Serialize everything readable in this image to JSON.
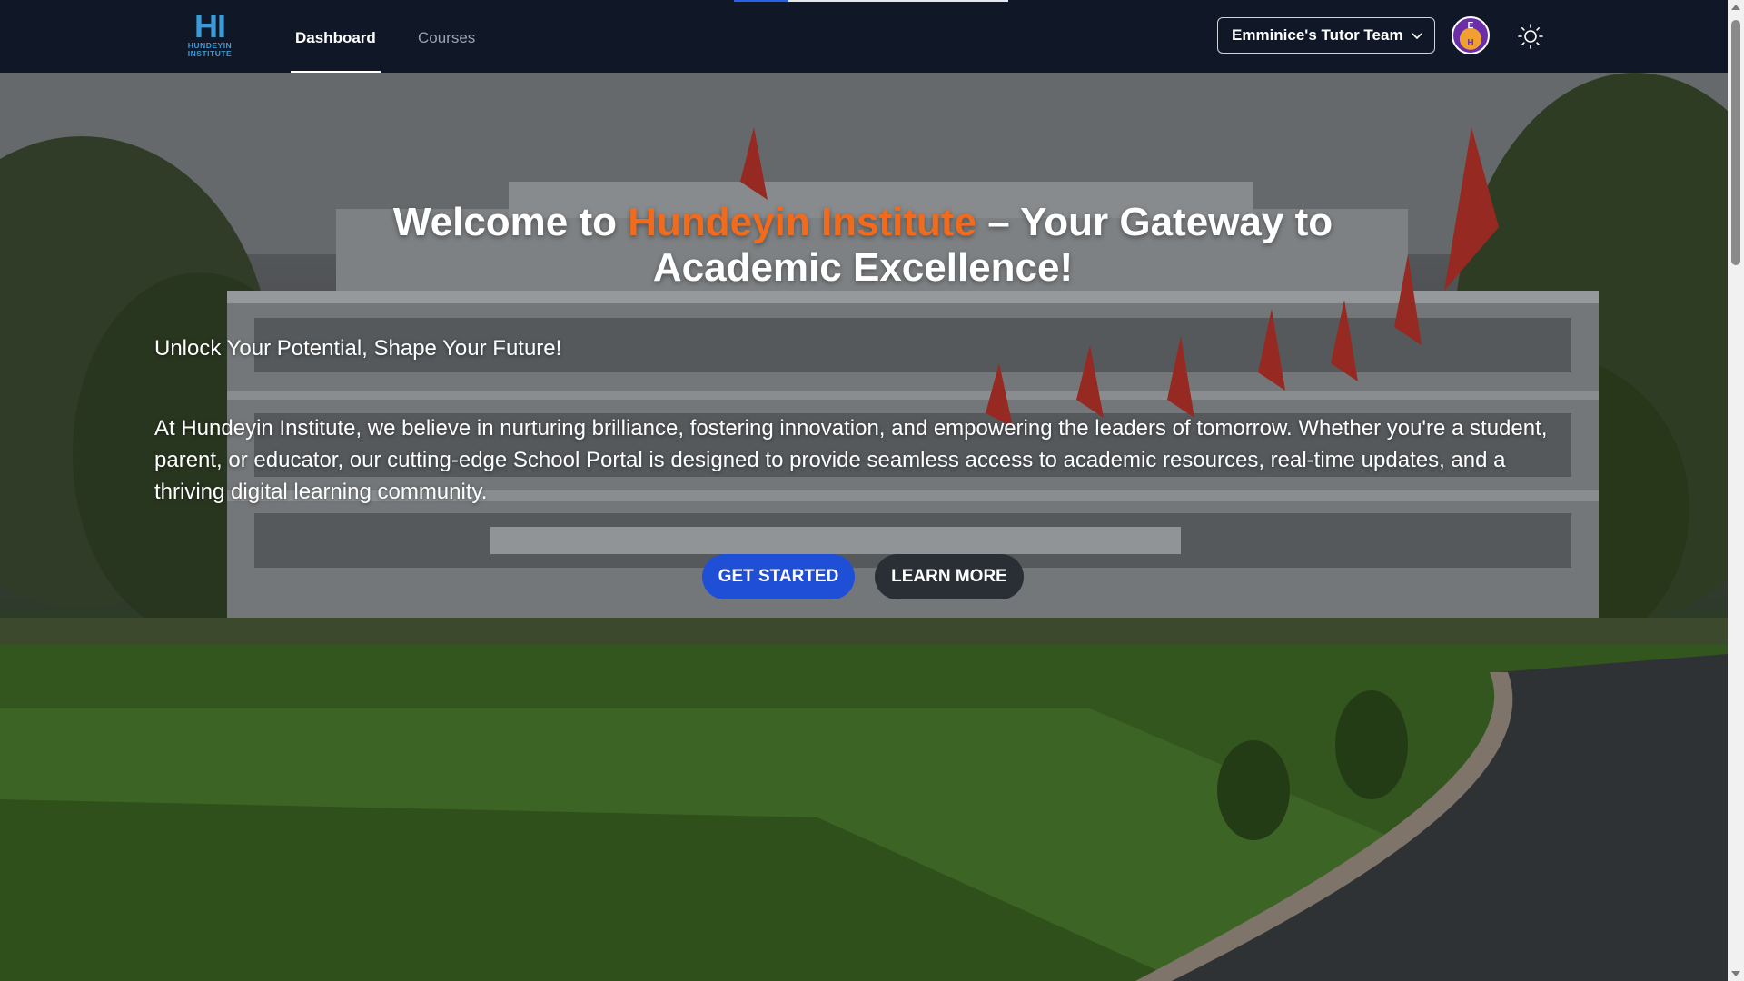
{
  "nav": {
    "logo": {
      "mark": "HI",
      "text_line1": "HUNDEYIN",
      "text_line2": "INSTITUTE"
    },
    "tabs": [
      {
        "label": "Dashboard",
        "active": true
      },
      {
        "label": "Courses",
        "active": false
      }
    ],
    "team_select": {
      "value": "Emminice's Tutor Team"
    },
    "avatar": {
      "initials_top": "E",
      "initials_bottom": "H"
    },
    "theme_toggle_icon": "sun-icon",
    "progress": 0.2
  },
  "hero": {
    "title_prefix": "Welcome to ",
    "title_brand": "Hundeyin Institute",
    "title_suffix": " – Your Gateway to Academic Excellence!",
    "subtitle": "Unlock Your Potential, Shape Your Future!",
    "body": "At Hundeyin Institute, we believe in nurturing brilliance, fostering innovation, and empowering the leaders of tomorrow. Whether you're a student, parent, or educator, our cutting-edge School Portal is designed to provide seamless access to academic resources, real-time updates, and a thriving digital learning community.",
    "primary_button": "GET STARTED",
    "secondary_button": "LEARN MORE"
  },
  "colors": {
    "nav_bg": "#101828",
    "brand_orange": "#f26a1b",
    "primary_blue": "#1f4fd6",
    "logo_blue": "#3b9bd8"
  }
}
